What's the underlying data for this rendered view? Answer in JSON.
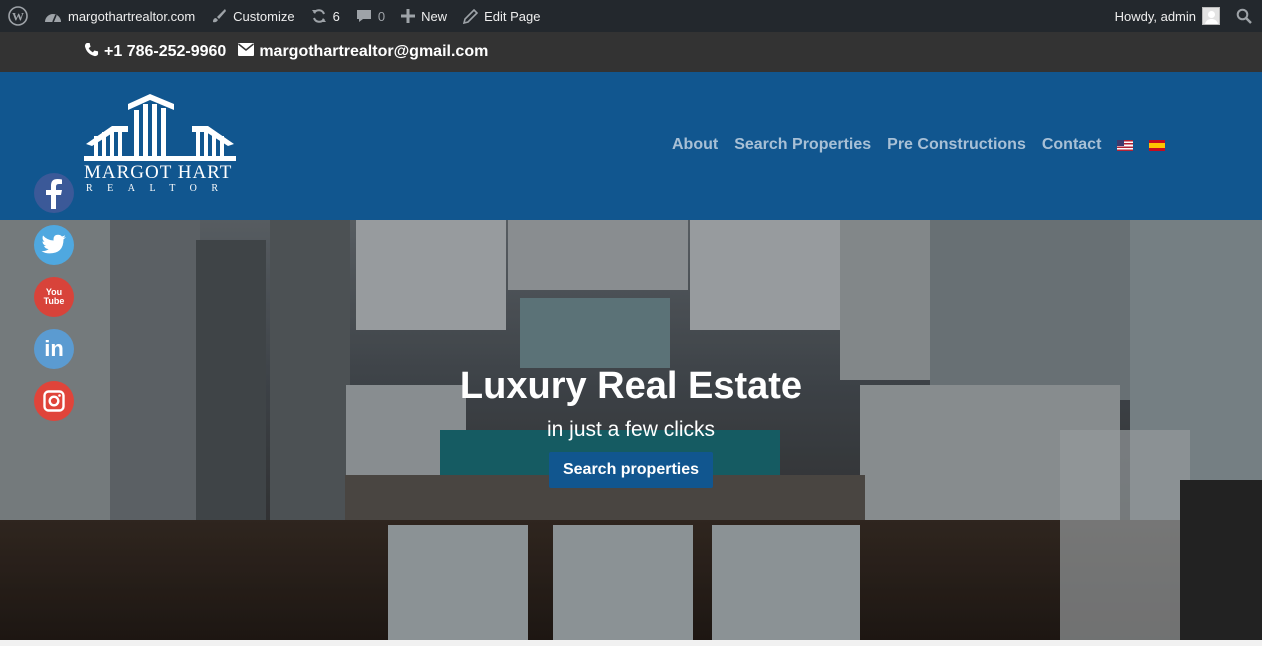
{
  "adminbar": {
    "site_name": "margothartrealtor.com",
    "customize": "Customize",
    "updates": "6",
    "comments": "0",
    "new": "New",
    "edit_page": "Edit Page",
    "howdy": "Howdy, admin"
  },
  "contact": {
    "phone": "+1 786-252-9960",
    "email": "margothartrealtor@gmail.com"
  },
  "logo": {
    "name": "MARGOT HART",
    "sub": "REALTOR"
  },
  "nav": {
    "items": [
      "About",
      "Search Properties",
      "Pre Constructions",
      "Contact"
    ]
  },
  "hero": {
    "title": "Luxury Real Estate",
    "subtitle": "in just a few clicks",
    "button": "Search properties"
  },
  "social": {
    "youtube_text": "You Tube",
    "linkedin_text": "in"
  },
  "colors": {
    "header": "#11568f",
    "adminbar": "#23282d",
    "contactbar": "#333333",
    "button": "#11568f"
  }
}
